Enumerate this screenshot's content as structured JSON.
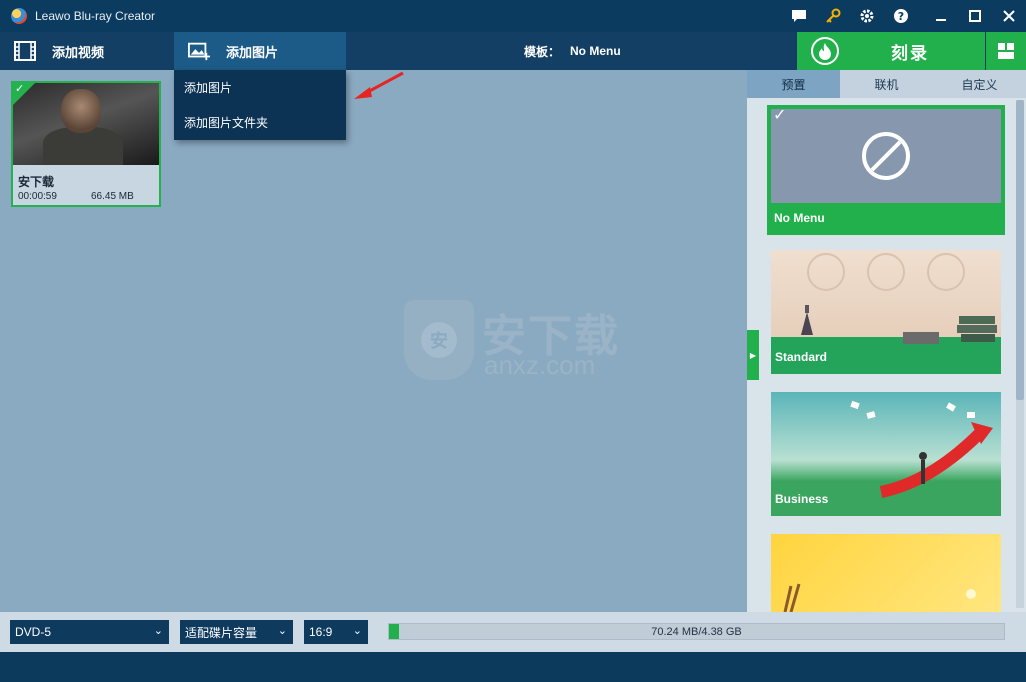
{
  "window": {
    "title": "Leawo Blu-ray Creator"
  },
  "toolbar": {
    "add_video": "添加视频",
    "add_photo": "添加图片",
    "template_label": "模板：",
    "template_value": "No Menu",
    "burn": "刻录"
  },
  "dropdown": {
    "items": [
      "添加图片",
      "添加图片文件夹"
    ]
  },
  "clip": {
    "title": "安下载",
    "duration": "00:00:59",
    "size": "66.45 MB"
  },
  "watermark": {
    "big": "安下载",
    "small": "anxz.com",
    "shield": "安"
  },
  "panel": {
    "tabs": [
      "预置",
      "联机",
      "自定义"
    ],
    "templates": [
      "No Menu",
      "Standard",
      "Business"
    ]
  },
  "bottom": {
    "disc": "DVD-5",
    "fit": "适配碟片容量",
    "ratio": "16:9",
    "capacity": "70.24 MB/4.38 GB",
    "capacity_fraction": 0.016
  },
  "colors": {
    "accent": "#21b04b",
    "titlebar": "#0b3b5f",
    "canvas": "#8aaac2"
  }
}
